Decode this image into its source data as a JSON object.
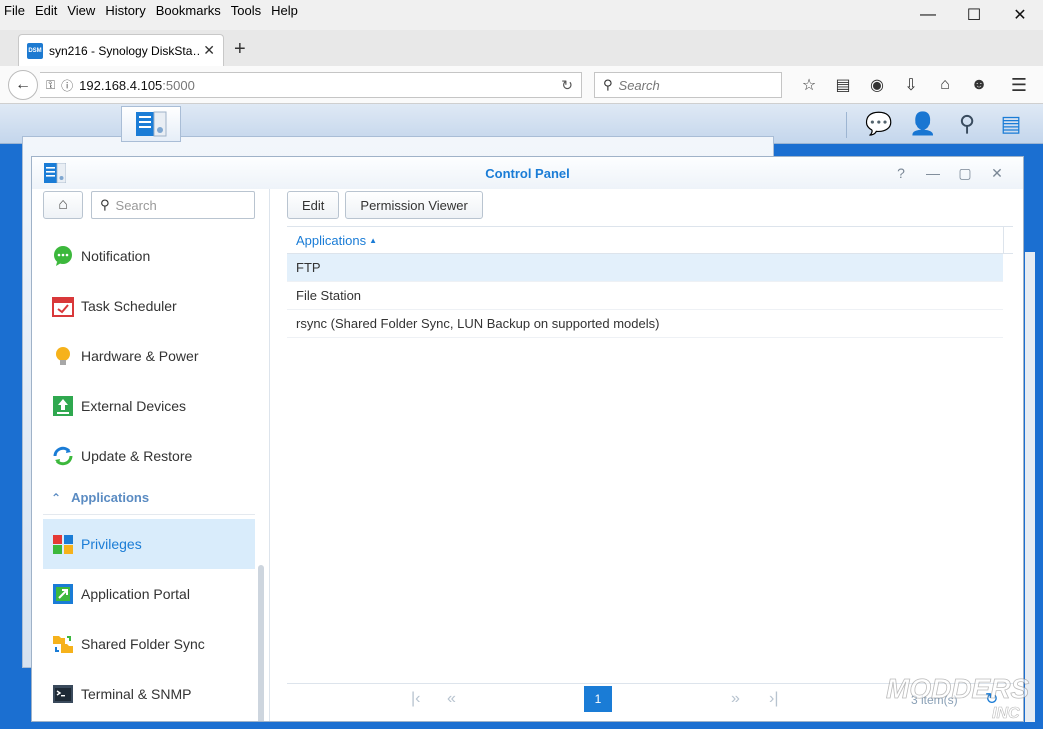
{
  "browser": {
    "menu": [
      "File",
      "Edit",
      "View",
      "History",
      "Bookmarks",
      "Tools",
      "Help"
    ],
    "tab_title": "syn216 - Synology DiskSta…",
    "favicon_text": "DSM",
    "url_host": "192.168.4.105",
    "url_port": ":5000",
    "search_placeholder": "Search"
  },
  "dsm": {
    "window_title": "Control Panel",
    "sidebar": {
      "search_placeholder": "Search",
      "items_top": [
        {
          "label": "Notification",
          "icon": "notification-icon"
        },
        {
          "label": "Task Scheduler",
          "icon": "task-scheduler-icon"
        },
        {
          "label": "Hardware & Power",
          "icon": "hardware-power-icon"
        },
        {
          "label": "External Devices",
          "icon": "external-devices-icon"
        },
        {
          "label": "Update & Restore",
          "icon": "update-restore-icon"
        }
      ],
      "group_label": "Applications",
      "items_apps": [
        {
          "label": "Privileges",
          "icon": "privileges-icon",
          "selected": true
        },
        {
          "label": "Application Portal",
          "icon": "application-portal-icon"
        },
        {
          "label": "Shared Folder Sync",
          "icon": "shared-folder-sync-icon"
        },
        {
          "label": "Terminal & SNMP",
          "icon": "terminal-snmp-icon"
        }
      ]
    },
    "toolbar": {
      "edit_label": "Edit",
      "permission_viewer_label": "Permission Viewer"
    },
    "table": {
      "column": "Applications",
      "rows": [
        "FTP",
        "File Station",
        "rsync (Shared Folder Sync, LUN Backup on supported models)"
      ]
    },
    "pager": {
      "current_page": "1",
      "count": "3 item(s)"
    }
  },
  "watermark": {
    "text_line1": "MODDERS",
    "text_line2": "INC"
  },
  "colors": {
    "accent": "#1a7cd6",
    "desktop": "#1b6fd1",
    "selection": "#d9ecfb"
  }
}
